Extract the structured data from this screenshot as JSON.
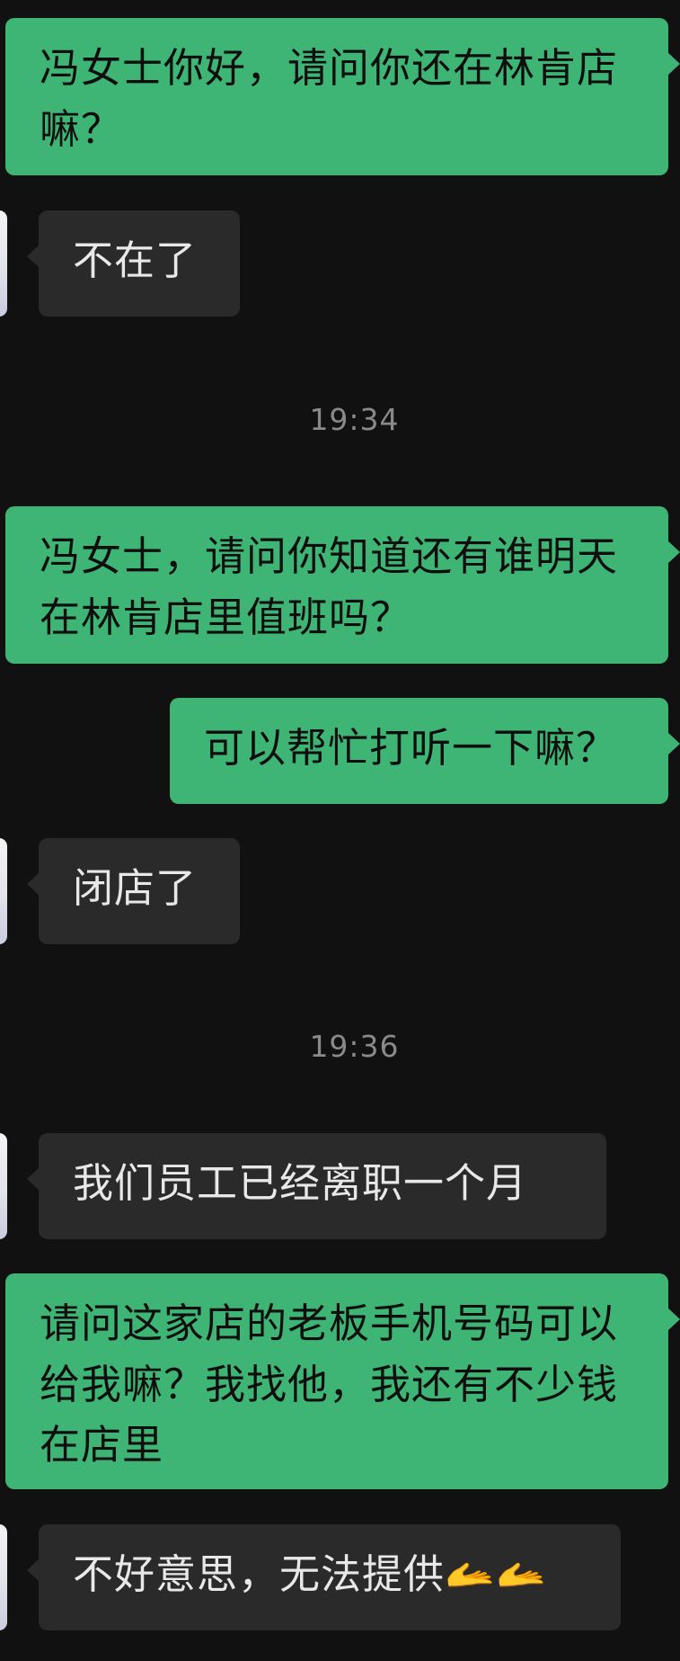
{
  "chat": {
    "messages": [
      {
        "direction": "out",
        "text": "冯女士你好，请问你还在林肯店嘛？"
      },
      {
        "direction": "in",
        "text": "不在了"
      },
      {
        "direction": "out",
        "text": "冯女士，请问你知道还有谁明天在林肯店里值班吗？"
      },
      {
        "direction": "out",
        "text": "可以帮忙打听一下嘛？"
      },
      {
        "direction": "in",
        "text": "闭店了"
      },
      {
        "direction": "in",
        "text": "我们员工已经离职一个月"
      },
      {
        "direction": "out",
        "text": "请问这家店的老板手机号码可以给我嘛？我找他，我还有不少钱在店里"
      },
      {
        "direction": "in",
        "text": "不好意思，无法提供🫴🫴"
      }
    ],
    "timestamps": [
      "19:34",
      "19:36"
    ]
  },
  "colors": {
    "background": "#111111",
    "outgoing_bubble": "#3eb574",
    "incoming_bubble": "#2a2a2a",
    "timestamp_text": "#8a8a8a"
  }
}
